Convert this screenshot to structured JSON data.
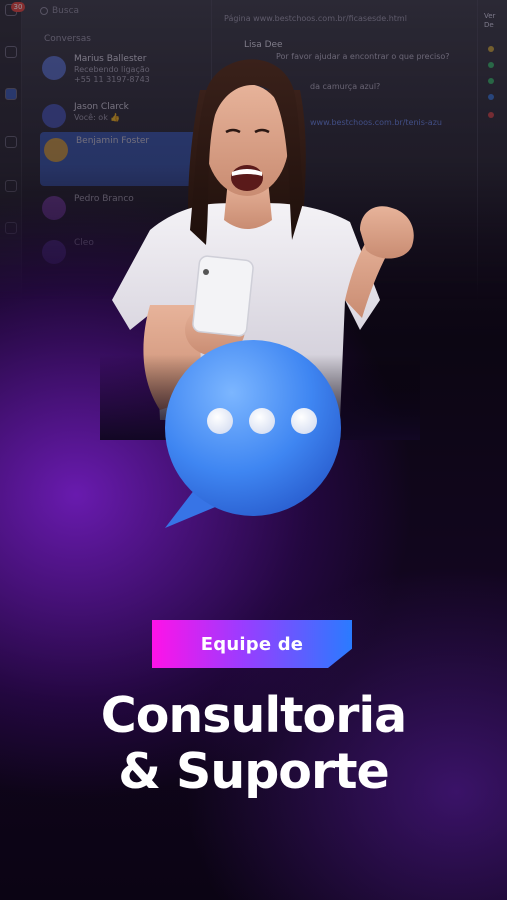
{
  "backdrop": {
    "rail_badge": "30",
    "search_placeholder": "Busca",
    "list_heading": "Conversas",
    "conversations": [
      {
        "name": "Marius Ballester",
        "preview": "Recebendo ligação",
        "extra": "+55 11 3197-8743",
        "time": ""
      },
      {
        "name": "Jason Clarck",
        "preview": "Você: ok 👍",
        "extra": "",
        "time": ""
      },
      {
        "name": "Benjamin Foster",
        "preview": "",
        "extra": "",
        "time": ""
      },
      {
        "name": "Pedro Branco",
        "preview": "",
        "extra": "",
        "time": ""
      },
      {
        "name": "Cleo",
        "preview": "",
        "extra": "",
        "time": ""
      }
    ],
    "chat": {
      "url": "Página www.bestchoos.com.br/ficasesde.html",
      "author": "Lisa Dee",
      "messages": [
        "Por favor ajudar a encontrar o que preciso?",
        "da camurça azul?"
      ],
      "link": "www.bestchoos.com.br/tenis-azu"
    },
    "right_panel": {
      "label": "Ver",
      "sub": "De"
    }
  },
  "tag": {
    "label": "Equipe de"
  },
  "headline": {
    "line1": "Consultoria",
    "line2": "& Suporte"
  },
  "colors": {
    "tag_start": "#ff12e8",
    "tag_mid": "#9b3cff",
    "tag_end": "#2a7bff",
    "bubble": "#3f86f2",
    "headline": "#ffffff",
    "glow": "#7a1ecb"
  }
}
